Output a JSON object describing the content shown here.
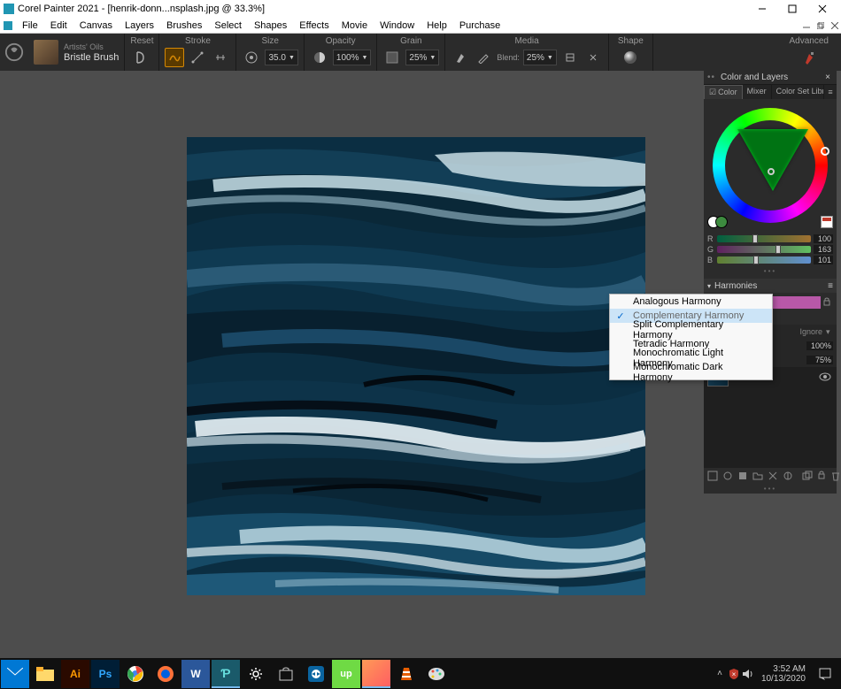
{
  "titlebar": {
    "app_name": "Corel Painter 2021",
    "doc_name": "[henrik-donn...nsplash.jpg @ 33.3%]"
  },
  "menubar": {
    "items": [
      "File",
      "Edit",
      "Canvas",
      "Layers",
      "Brushes",
      "Select",
      "Shapes",
      "Effects",
      "Movie",
      "Window",
      "Help",
      "Purchase"
    ]
  },
  "propbar": {
    "brush_category": "Artists' Oils",
    "brush_name": "Bristle Brush",
    "groups": {
      "reset": "Reset",
      "stroke": "Stroke",
      "size": "Size",
      "size_val": "35.0",
      "opacity": "Opacity",
      "opacity_val": "100%",
      "grain": "Grain",
      "grain_val": "25%",
      "media": "Media",
      "blend_label": "Blend:",
      "blend_val": "25%",
      "shape": "Shape",
      "advanced": "Advanced"
    }
  },
  "sidepanel": {
    "title": "Color and Layers",
    "tabs": [
      "Color",
      "Mixer",
      "Color Set Libraries"
    ],
    "rgb": {
      "r": "100",
      "g": "163",
      "b": "101"
    },
    "harmonies_label": "Harmonies",
    "ignore_label": "Ignore",
    "opacity_row": "100%",
    "fill_row": "75%"
  },
  "context_menu": {
    "items": [
      "Analogous Harmony",
      "Complementary Harmony",
      "Split Complementary Harmony",
      "Tetradic Harmony",
      "Monochromatic Light Harmony",
      "Monochromatic Dark Harmony"
    ],
    "selected_index": 1
  },
  "taskbar": {
    "time": "3:52 AM",
    "date": "10/13/2020"
  }
}
